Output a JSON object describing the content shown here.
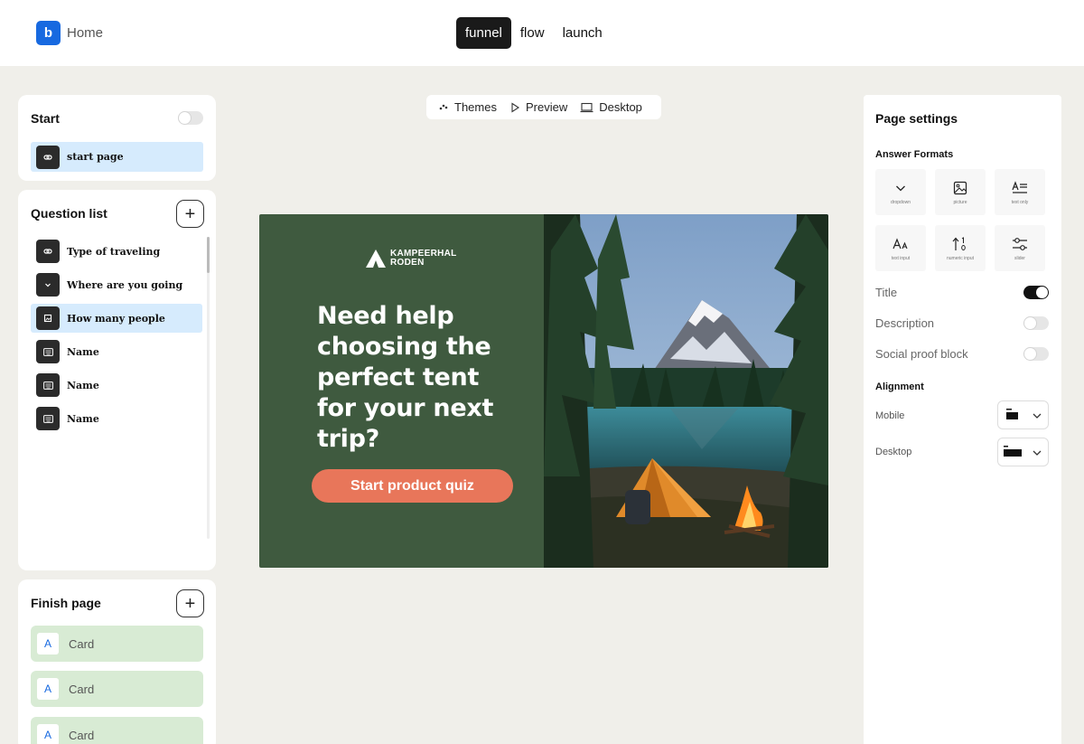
{
  "header": {
    "logo_letter": "b",
    "home_label": "Home",
    "tabs": [
      {
        "label": "funnel",
        "active": true
      },
      {
        "label": "flow",
        "active": false
      },
      {
        "label": "launch",
        "active": false
      }
    ]
  },
  "start_panel": {
    "title": "Start",
    "toggle_on": false,
    "item": {
      "label": "start page",
      "icon": "link-icon"
    }
  },
  "question_list": {
    "title": "Question list",
    "add_icon": "plus-icon",
    "items": [
      {
        "label": "Type of traveling",
        "icon": "link-icon",
        "selected": false
      },
      {
        "label": "Where are you going",
        "icon": "chevron-down-icon",
        "selected": false
      },
      {
        "label": "How many people",
        "icon": "image-icon",
        "selected": true
      },
      {
        "label": "Name",
        "icon": "keyboard-icon",
        "selected": false
      },
      {
        "label": "Name",
        "icon": "keyboard-icon",
        "selected": false
      },
      {
        "label": "Name",
        "icon": "keyboard-icon",
        "selected": false
      }
    ]
  },
  "finish_page": {
    "title": "Finish page",
    "add_icon": "plus-icon",
    "cards": [
      {
        "badge": "A",
        "label": "Card"
      },
      {
        "badge": "A",
        "label": "Card"
      },
      {
        "badge": "A",
        "label": "Card"
      }
    ]
  },
  "toolbar": {
    "themes": "Themes",
    "preview": "Preview",
    "desktop": "Desktop"
  },
  "preview": {
    "brand_line1": "KAMPEERHAL",
    "brand_line2": "RODEN",
    "headline_lines": [
      "Need help",
      "choosing the",
      "perfect tent",
      "for your next",
      "trip?"
    ],
    "cta": "Start product quiz",
    "colors": {
      "panel": "#3f5a3f",
      "cta": "#e8765a"
    }
  },
  "page_settings": {
    "title": "Page settings",
    "answer_formats_label": "Answer Formats",
    "formats": [
      {
        "label": "dropdown",
        "icon": "chevron-down-icon"
      },
      {
        "label": "picture",
        "icon": "image-icon"
      },
      {
        "label": "text only",
        "icon": "text-icon"
      },
      {
        "label": "text input",
        "icon": "font-size-icon"
      },
      {
        "label": "numeric input",
        "icon": "sort-numeric-icon"
      },
      {
        "label": "slider",
        "icon": "slider-icon"
      }
    ],
    "toggles": [
      {
        "label": "Title",
        "on": true
      },
      {
        "label": "Description",
        "on": false
      },
      {
        "label": "Social proof block",
        "on": false
      }
    ],
    "alignment_label": "Alignment",
    "alignment": [
      {
        "label": "Mobile"
      },
      {
        "label": "Desktop"
      }
    ]
  }
}
